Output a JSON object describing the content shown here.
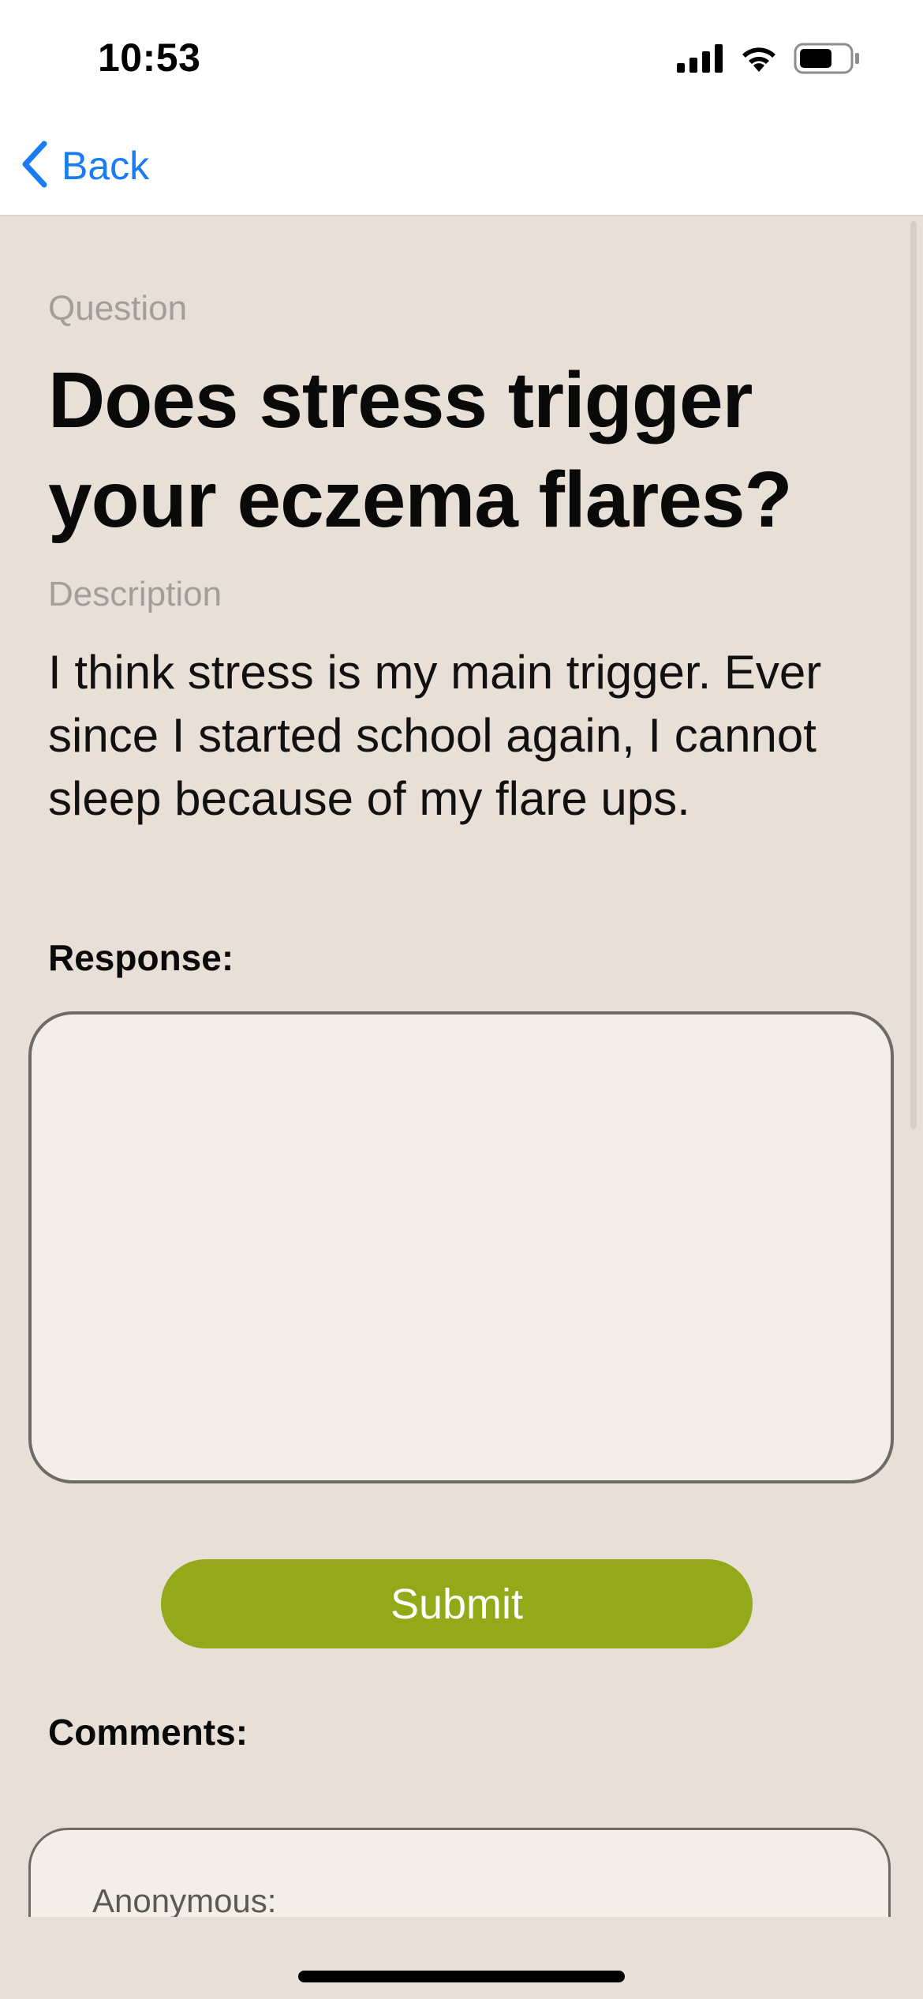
{
  "status_bar": {
    "time": "10:53",
    "icons": [
      "cellular-signal-icon",
      "wifi-icon",
      "battery-icon"
    ]
  },
  "nav": {
    "back_label": "Back",
    "back_icon": "chevron-left-icon",
    "accent_color": "#1a7cf3"
  },
  "question": {
    "label": "Question",
    "title": "Does stress trigger your eczema flares?"
  },
  "description": {
    "label": "Description",
    "text": "I think stress is my main trigger. Ever since I started school again, I cannot sleep because of my flare ups."
  },
  "response": {
    "label": "Response:",
    "value": ""
  },
  "submit": {
    "label": "Submit",
    "color": "#93a919"
  },
  "comments": {
    "label": "Comments:",
    "items": [
      {
        "author": "Anonymous:"
      }
    ]
  },
  "colors": {
    "background": "#e8dfd6",
    "field_background": "#f3eee8"
  }
}
